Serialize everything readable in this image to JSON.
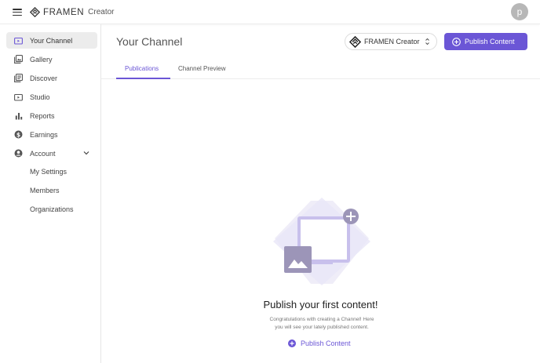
{
  "app": {
    "brand": "FRAMEN",
    "product": "Creator",
    "user_initial": "p"
  },
  "sidebar": {
    "items": [
      {
        "label": "Your Channel",
        "icon": "channel-icon",
        "active": true
      },
      {
        "label": "Gallery",
        "icon": "gallery-icon"
      },
      {
        "label": "Discover",
        "icon": "discover-icon"
      },
      {
        "label": "Studio",
        "icon": "studio-icon"
      },
      {
        "label": "Reports",
        "icon": "bar-chart-icon"
      },
      {
        "label": "Earnings",
        "icon": "dollar-icon"
      },
      {
        "label": "Account",
        "icon": "user-circle-icon",
        "expanded": true
      }
    ],
    "account_subitems": [
      "My Settings",
      "Members",
      "Organizations"
    ]
  },
  "header": {
    "title": "Your Channel",
    "channel_selector": "FRAMEN Creator",
    "publish_button": "Publish Content"
  },
  "tabs": [
    {
      "label": "Publications",
      "active": true
    },
    {
      "label": "Channel Preview",
      "active": false
    }
  ],
  "empty_state": {
    "title": "Publish your first content!",
    "description_line1": "Congratulations with creating a Channel! Here",
    "description_line2": "you will see your lately published content.",
    "action": "Publish Content"
  },
  "colors": {
    "accent": "#6b56d6",
    "illustration_light": "#e6e2f6",
    "illustration_mid": "#c8c0ec",
    "illustration_dark": "#9c95b8"
  }
}
